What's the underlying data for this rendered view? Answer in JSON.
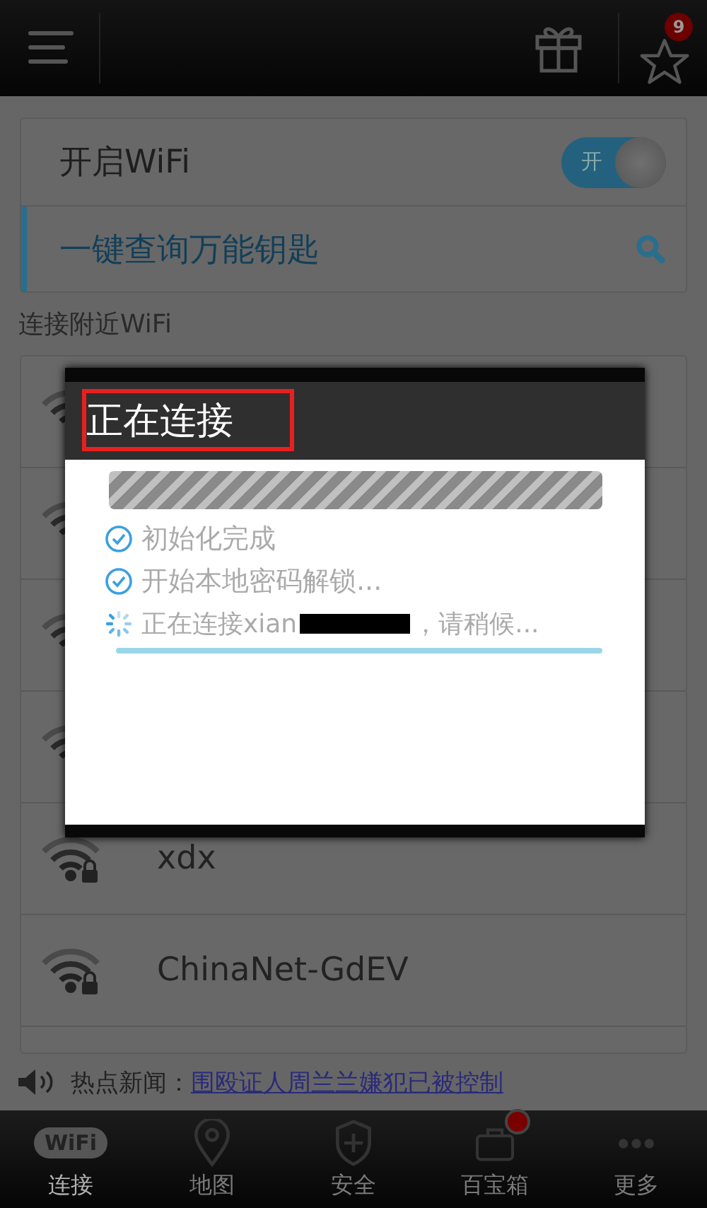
{
  "top_bar": {
    "star_badge": "9"
  },
  "wifi_toggle": {
    "label": "开启WiFi",
    "on": true,
    "switch_text": "开"
  },
  "search_row": {
    "label": "一键查询万能钥匙"
  },
  "section_label": "连接附近WiFi",
  "networks": [
    {
      "kind": "covered"
    },
    {
      "kind": "covered"
    },
    {
      "kind": "covered"
    },
    {
      "kind": "covered"
    },
    {
      "kind": "named",
      "name": "xdx"
    },
    {
      "kind": "named",
      "name": "ChinaNet-GdEV"
    }
  ],
  "news": {
    "label": "热点新闻：",
    "link": "围殴证人周兰兰嫌犯已被控制"
  },
  "bottom_nav": [
    {
      "label": "连接",
      "kind": "wifi",
      "logo": "WiFi",
      "selected": true,
      "badge": false
    },
    {
      "label": "地图",
      "kind": "map",
      "selected": false,
      "badge": false
    },
    {
      "label": "安全",
      "kind": "security",
      "selected": false,
      "badge": false
    },
    {
      "label": "百宝箱",
      "kind": "toolbox",
      "selected": false,
      "badge": true
    },
    {
      "label": "更多",
      "kind": "more",
      "selected": false,
      "badge": false
    }
  ],
  "dialog": {
    "title": "正在连接",
    "title_highlighted": true,
    "steps": [
      {
        "kind": "done",
        "text": "初始化完成"
      },
      {
        "kind": "done",
        "text": "开始本地密码解锁..."
      },
      {
        "kind": "loading",
        "text": "正在连接xian",
        "text_after": "，请稍候...",
        "redacted": true
      }
    ]
  }
}
